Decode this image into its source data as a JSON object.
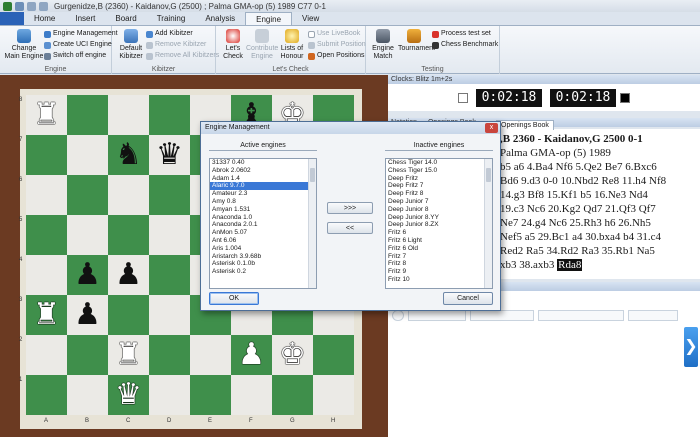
{
  "window": {
    "title": "Gurgenidze,B (2360) - Kaidanov,G (2500) ; Palma GMA-op (5) 1989  C77  0-1"
  },
  "tabs": [
    {
      "label": ""
    },
    {
      "label": "Home"
    },
    {
      "label": "Insert"
    },
    {
      "label": "Board"
    },
    {
      "label": "Training"
    },
    {
      "label": "Analysis"
    },
    {
      "label": "Engine"
    },
    {
      "label": "View"
    }
  ],
  "ribbon": {
    "engine_group": {
      "label": "Engine",
      "change_main_engine": "Change Main Engine",
      "engine_management": "Engine Management",
      "create_uci_engine": "Create UCI Engine",
      "switch_off_engine": "Switch off engine"
    },
    "kibitzer_group": {
      "label": "Kibitzer",
      "default_kibitzer": "Default Kibitzer",
      "add_kibitzer": "Add Kibitzer",
      "remove_kibitzer": "Remove Kibitzer",
      "remove_all_kibitzers": "Remove All Kibitzers"
    },
    "letscheck_group": {
      "label": "Let's Check",
      "lets_check": "Let's Check",
      "contribute_engine": "Contribute Engine",
      "lists_of_honour": "Lists of Honour",
      "use_livebook": "Use LiveBook",
      "submit_position": "Submit Position",
      "open_positions": "Open Positions"
    },
    "testing_group": {
      "label": "Testing",
      "engine_match": "Engine Match",
      "tournament": "Tournament",
      "process_test_set": "Process test set",
      "chess_benchmark": "Chess Benchmark"
    }
  },
  "board": {
    "ranks": [
      "8",
      "7",
      "6",
      "5",
      "4",
      "3",
      "2",
      "1"
    ],
    "files": [
      "A",
      "B",
      "C",
      "D",
      "E",
      "F",
      "G",
      "H"
    ],
    "pieces": {
      "a8": {
        "glyph": "♜",
        "color": "white"
      },
      "f8": {
        "glyph": "♝",
        "color": "black"
      },
      "g8": {
        "glyph": "♚",
        "color": "white"
      },
      "c7": {
        "glyph": "♞",
        "color": "black"
      },
      "d7": {
        "glyph": "♛",
        "color": "black"
      },
      "b4": {
        "glyph": "♟",
        "color": "black"
      },
      "c4": {
        "glyph": "♟",
        "color": "black"
      },
      "b3": {
        "glyph": "♟",
        "color": "black"
      },
      "a3": {
        "glyph": "♜",
        "color": "white"
      },
      "c2": {
        "glyph": "♜",
        "color": "white"
      },
      "f2": {
        "glyph": "♟",
        "color": "white"
      },
      "g2": {
        "glyph": "♚",
        "color": "white"
      },
      "c1": {
        "glyph": "♛",
        "color": "white"
      }
    }
  },
  "clocks": {
    "header": "Clocks: Blitz 1m+2s",
    "white_time": "0:02:18",
    "black_time": "0:02:18"
  },
  "notation": {
    "pane_header": "Notation — Openings Book",
    "tab_label": "Openings Book",
    "lines": [
      {
        "text": ",B 2360 - Kaidanov,G 2500  0-1",
        "highlight": ""
      },
      {
        "text": "Palma GMA-op (5) 1989",
        "highlight": ""
      },
      {
        "text": "b5  a6  4.Ba4  Nf6  5.Qe2  Be7  6.Bxc6",
        "highlight": ""
      },
      {
        "text": "Bd6  9.d3  0-0  10.Nbd2  Re8  11.h4  Nf8",
        "highlight": ""
      },
      {
        "text": "14.g3  Bf8  15.Kf1  b5  16.Ne3  Nd4",
        "highlight": ""
      },
      {
        "text": "19.c3  Nc6  20.Kg2  Qd7  21.Qf3  Qf7",
        "highlight": ""
      },
      {
        "text": "Ne7  24.g4  Nc6  25.Rh3  h6  26.Nh5",
        "highlight": ""
      },
      {
        "text": "Nef5  a5  29.Bc1  a4  30.bxa4  b4  31.c4",
        "highlight": ""
      },
      {
        "text": "Red2  Ra5  34.Rd2  Ra3  35.Rb1  Na5",
        "highlight": ""
      },
      {
        "text": "xb3  38.axb3 ",
        "highlight": "Rda8"
      }
    ]
  },
  "dialog": {
    "title": "Engine Management",
    "close": "x",
    "active_header": "Active engines",
    "inactive_header": "Inactive engines",
    "active_engines": [
      "31337 0.40",
      "Abrok 2.0602",
      "Adam 1.4",
      "Alaric 9.7.0",
      "Amateur 2.3",
      "Amy 0.8",
      "Amyan 1.531",
      "Anaconda 1.0",
      "Anaconda 2.0.1",
      "AnMon 5.07",
      "Ant 6.06",
      "Aris 1.004",
      "Aristarch 3.9.68b",
      "Asterisk 0.1.0b",
      "Asterisk 0.2"
    ],
    "active_selected_index": 3,
    "inactive_engines": [
      "Chess Tiger 14.0",
      "Chess Tiger 15.0",
      "Deep Fritz",
      "Deep Fritz 7",
      "Deep Fritz 8",
      "Deep Junior 7",
      "Deep Junior 8",
      "Deep Junior 8.YY",
      "Deep Junior 8.ZX",
      "Fritz 6",
      "Fritz 6 Light",
      "Fritz 6 Old",
      "Fritz 7",
      "Fritz 8",
      "Fritz 9",
      "Fritz 10"
    ],
    "move_right": ">>>",
    "move_left": "<<",
    "ok": "OK",
    "cancel": "Cancel"
  }
}
